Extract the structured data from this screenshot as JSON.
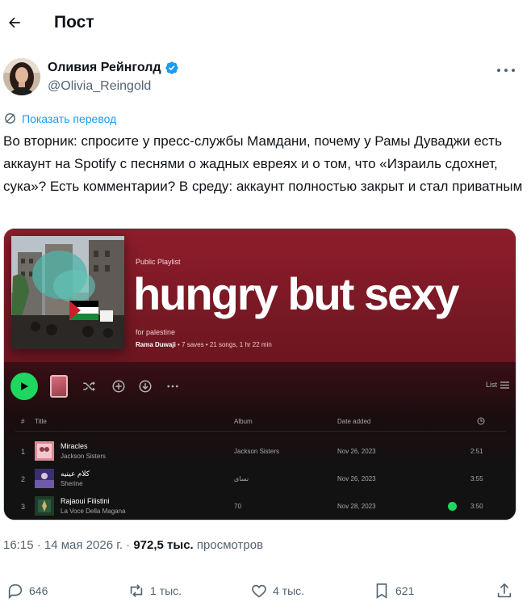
{
  "header": {
    "title": "Пост"
  },
  "author": {
    "name": "Оливия Рейнголд",
    "handle": "@Olivia_Reingold"
  },
  "translate": {
    "label": "Показать перевод"
  },
  "tweet": {
    "text": "Во вторник: спросите у пресс-службы Мамдани, почему у Рамы Дуваджи есть аккаунт на Spotify с песнями о жадных евреях и о том, что «Израиль сдохнет, сука»? Есть комментарии? В среду: аккаунт полностью закрыт и стал приватным"
  },
  "spotify": {
    "type": "Public Playlist",
    "title": "hungry but sexy",
    "description": "for palestine",
    "owner": "Rama Duwaji",
    "meta": " • 7 saves • 21 songs, 1 hr 22 min",
    "view_label": "List",
    "columns": {
      "num": "#",
      "title": "Title",
      "album": "Album",
      "date": "Date added"
    },
    "tracks": [
      {
        "num": "1",
        "title": "Miracles",
        "artist": "Jackson Sisters",
        "album": "Jackson Sisters",
        "date": "Nov 26, 2023",
        "duration": "2:51",
        "saved": false
      },
      {
        "num": "2",
        "title": "كلام عينيه",
        "artist": "Sherine",
        "album": "نساى",
        "date": "Nov 26, 2023",
        "duration": "3:55",
        "saved": false
      },
      {
        "num": "3",
        "title": "Rajaoui Filistini",
        "artist": "La Voce Della Magana",
        "album": "70",
        "date": "Nov 28, 2023",
        "duration": "3:50",
        "saved": true
      }
    ],
    "colors": {
      "accent": "#1ed760",
      "header": "#8e1d2a"
    }
  },
  "meta": {
    "time": "16:15 · 14 мая 2026 г. · ",
    "views": "972,5 тыс.",
    "views_label": " просмотров"
  },
  "actions": {
    "replies": "646",
    "reposts": "1 тыс.",
    "likes": "4 тыс.",
    "bookmarks": "621"
  },
  "colors": {
    "link": "#1d9bf0",
    "muted": "#536471"
  }
}
